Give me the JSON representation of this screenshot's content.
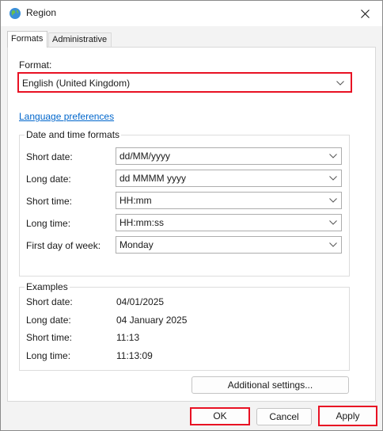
{
  "window": {
    "title": "Region",
    "app_icon": "globe-icon",
    "close_icon": "close-icon"
  },
  "tabs": [
    {
      "label": "Formats",
      "active": true
    },
    {
      "label": "Administrative",
      "active": false
    }
  ],
  "format": {
    "label": "Format:",
    "value": "English (United Kingdom)"
  },
  "language_link": "Language preferences",
  "date_time_formats": {
    "title": "Date and time formats",
    "rows": [
      {
        "label": "Short date:",
        "value": "dd/MM/yyyy"
      },
      {
        "label": "Long date:",
        "value": "dd MMMM yyyy"
      },
      {
        "label": "Short time:",
        "value": "HH:mm"
      },
      {
        "label": "Long time:",
        "value": "HH:mm:ss"
      },
      {
        "label": "First day of week:",
        "value": "Monday"
      }
    ]
  },
  "examples": {
    "title": "Examples",
    "rows": [
      {
        "label": "Short date:",
        "value": "04/01/2025"
      },
      {
        "label": "Long date:",
        "value": "04 January 2025"
      },
      {
        "label": "Short time:",
        "value": "11:13"
      },
      {
        "label": "Long time:",
        "value": "11:13:09"
      }
    ]
  },
  "buttons": {
    "additional": "Additional settings...",
    "ok": "OK",
    "cancel": "Cancel",
    "apply": "Apply"
  },
  "colors": {
    "highlight": "#e81123",
    "link": "#0066cc"
  }
}
